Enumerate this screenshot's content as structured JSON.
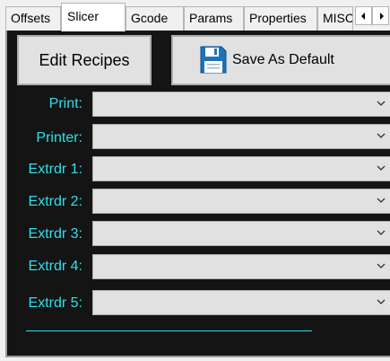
{
  "tabs": [
    {
      "label": "Offsets"
    },
    {
      "label": "Slicer"
    },
    {
      "label": "Gcode"
    },
    {
      "label": "Params"
    },
    {
      "label": "Properties"
    },
    {
      "label": "MISC"
    }
  ],
  "active_tab": "Slicer",
  "toolbar": {
    "edit_recipes_label": "Edit Recipes",
    "save_default_label": "Save As Default"
  },
  "fields": [
    {
      "label": "Print:",
      "value": ""
    },
    {
      "label": "Printer:",
      "value": ""
    },
    {
      "label": "Extrdr 1:",
      "value": ""
    },
    {
      "label": "Extrdr 2:",
      "value": ""
    },
    {
      "label": "Extrdr 3:",
      "value": ""
    },
    {
      "label": "Extrdr 4:",
      "value": ""
    },
    {
      "label": "Extrdr 5:",
      "value": ""
    }
  ],
  "colors": {
    "panel_background": "#141414",
    "label_text": "#2ee0ea",
    "control_background": "#e1e1e1"
  },
  "icons": {
    "save": "floppy-disk-icon",
    "dropdown": "chevron-down-icon",
    "scroll_left": "triangle-left-icon",
    "scroll_right": "triangle-right-icon"
  }
}
